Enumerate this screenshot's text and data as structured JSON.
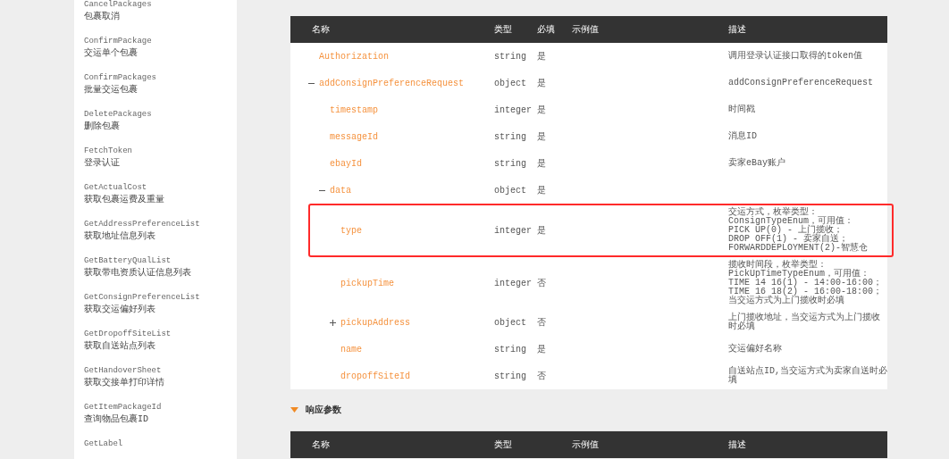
{
  "sidebar": {
    "items": [
      {
        "code": "CancelPackages",
        "label": "包裹取消"
      },
      {
        "code": "ConfirmPackage",
        "label": "交运单个包裹"
      },
      {
        "code": "ConfirmPackages",
        "label": "批量交运包裹"
      },
      {
        "code": "DeletePackages",
        "label": "删除包裹"
      },
      {
        "code": "FetchToken",
        "label": "登录认证"
      },
      {
        "code": "GetActualCost",
        "label": "获取包裹运费及重量"
      },
      {
        "code": "GetAddressPreferenceList",
        "label": "获取地址信息列表"
      },
      {
        "code": "GetBatteryQualList",
        "label": "获取带电资质认证信息列表"
      },
      {
        "code": "GetConsignPreferenceList",
        "label": "获取交运偏好列表"
      },
      {
        "code": "GetDropoffSiteList",
        "label": "获取自送站点列表"
      },
      {
        "code": "GetHandoverSheet",
        "label": "获取交接单打印详情"
      },
      {
        "code": "GetItemPackageId",
        "label": "查询物品包裹ID"
      },
      {
        "code": "GetLabel"
      }
    ]
  },
  "request_table": {
    "columns": [
      "名称",
      "类型",
      "必填",
      "示例值",
      "描述"
    ],
    "rows": [
      {
        "name": "Authorization",
        "type": "string",
        "required": "是",
        "description": "调用登录认证接口取得的token值",
        "highlighted": false
      },
      {
        "name": "addConsignPreferenceRequest",
        "type": "object",
        "required": "是",
        "description": "addConsignPreferenceRequest",
        "expanded": true,
        "highlighted": false,
        "children": [
          {
            "name": "timestamp",
            "type": "integer",
            "required": "是",
            "description": "时间戳",
            "highlighted": false
          },
          {
            "name": "messageId",
            "type": "string",
            "required": "是",
            "description": "消息ID",
            "highlighted": false
          },
          {
            "name": "ebayId",
            "type": "string",
            "required": "是",
            "description": "卖家eBay账户",
            "highlighted": false
          },
          {
            "name": "data",
            "type": "object",
            "required": "是",
            "expanded": true,
            "highlighted": false,
            "children": [
              {
                "name": "type",
                "type": "integer",
                "required": "是",
                "description": "交运方式，枚举类型：\nConsignTypeEnum，可用值：\nPICK UP(0) - 上门揽收；\nDROP OFF(1) - 卖家自送；\nFORWARDDEPLOYMENT(2)-智慧仓",
                "highlighted": true
              },
              {
                "name": "pickupTime",
                "type": "integer",
                "required": "否",
                "description": "揽收时间段，枚举类型：\nPickUpTimeTypeEnum，可用值：\nTIME 14 16(1) - 14:00-16:00；\nTIME 16 18(2) - 16:00-18:00；当交运方式为上门揽收时必填",
                "highlighted": false
              },
              {
                "name": "pickupAddress",
                "type": "object",
                "required": "否",
                "description": "上门揽收地址，当交运方式为上门揽收时必填",
                "expanded": false,
                "highlighted": false
              },
              {
                "name": "name",
                "type": "string",
                "required": "是",
                "description": "交运偏好名称",
                "highlighted": false
              },
              {
                "name": "dropoffSiteId",
                "type": "string",
                "required": "否",
                "description": "自送站点ID,当交运方式为卖家自送时必填",
                "highlighted": false
              }
            ]
          }
        ]
      }
    ]
  },
  "response_section": {
    "title": "响应参数",
    "expanded": true,
    "columns": [
      "名称",
      "类型",
      "示例值",
      "描述"
    ]
  }
}
